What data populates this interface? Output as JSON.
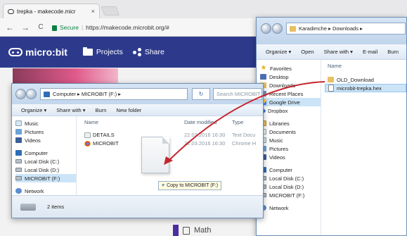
{
  "browser": {
    "tab_title": "trepka - makecode.micr",
    "tab_close": "×",
    "secure_label": "Secure",
    "url": "https://makecode.microbit.org/#",
    "back": "←",
    "forward": "→",
    "reload": "C"
  },
  "microbit": {
    "logo": "micro:bit",
    "projects": "Projects",
    "share": "Share",
    "math": "Math"
  },
  "downloads_window": {
    "breadcrumb": "Karadimche ▸ Downloads ▸",
    "commands": [
      "Organize ▾",
      "Open",
      "Share with ▾",
      "E-mail",
      "Burn"
    ],
    "nav_items": [
      {
        "label": "Favorites",
        "icon": "star-icon"
      },
      {
        "label": "Desktop",
        "icon": "desktop-icon"
      },
      {
        "label": "Downloads",
        "icon": "downloads-folder-icon"
      },
      {
        "label": "Recent Places",
        "icon": "recent-places-icon"
      },
      {
        "label": "Google Drive",
        "icon": "google-drive-icon"
      },
      {
        "label": "Dropbox",
        "icon": "dropbox-icon"
      },
      {
        "label": "",
        "icon": ""
      },
      {
        "label": "Libraries",
        "icon": "libraries-icon"
      },
      {
        "label": "Documents",
        "icon": "documents-icon"
      },
      {
        "label": "Music",
        "icon": "music-icon"
      },
      {
        "label": "Pictures",
        "icon": "pictures-icon"
      },
      {
        "label": "Videos",
        "icon": "videos-icon"
      },
      {
        "label": "",
        "icon": ""
      },
      {
        "label": "Computer",
        "icon": "computer-icon"
      },
      {
        "label": "Local Disk (C:)",
        "icon": "drive-icon"
      },
      {
        "label": "Local Disk (D:)",
        "icon": "drive-icon"
      },
      {
        "label": "MICROBIT (F:)",
        "icon": "drive-icon"
      },
      {
        "label": "",
        "icon": ""
      },
      {
        "label": "Network",
        "icon": "network-icon"
      }
    ],
    "column_name": "Name",
    "files": [
      {
        "name": "OLD_Download",
        "icon": "folder-icon"
      },
      {
        "name": "microbit-trepka.hex",
        "icon": "hex-file-icon"
      }
    ]
  },
  "microbit_window": {
    "breadcrumb": "Computer ▸ MICROBIT (F:) ▸",
    "search_placeholder": "Search MICROBIT",
    "commands": [
      "Organize ▾",
      "Share with ▾",
      "Burn",
      "New folder"
    ],
    "nav_items": [
      {
        "label": "Music",
        "icon": "music-icon"
      },
      {
        "label": "Pictures",
        "icon": "pictures-icon"
      },
      {
        "label": "Videos",
        "icon": "videos-icon"
      },
      {
        "label": "",
        "icon": ""
      },
      {
        "label": "Computer",
        "icon": "computer-icon"
      },
      {
        "label": "Local Disk (C:)",
        "icon": "drive-icon"
      },
      {
        "label": "Local Disk (D:)",
        "icon": "drive-icon"
      },
      {
        "label": "MICROBIT (F:)",
        "icon": "drive-icon"
      },
      {
        "label": "",
        "icon": ""
      },
      {
        "label": "Network",
        "icon": "network-icon"
      }
    ],
    "columns": {
      "name": "Name",
      "date": "Date modified",
      "type": "Type"
    },
    "files": [
      {
        "name": "DETAILS",
        "date": "22.03.2016 16:30",
        "type": "Text Docu",
        "icon": "text-file-icon"
      },
      {
        "name": "MICROBIT",
        "date": "22.03.2016 16:30",
        "type": "Chrome H",
        "icon": "chrome-html-icon"
      }
    ],
    "status": "2 items"
  },
  "drag": {
    "tooltip": "Copy to MICROBIT (F:)"
  }
}
